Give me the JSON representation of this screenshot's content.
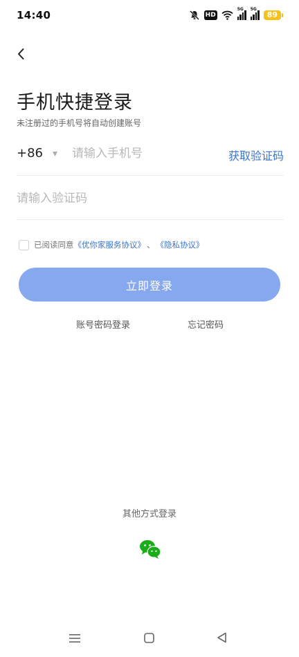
{
  "status_bar": {
    "time": "14:40",
    "hd_label": "HD",
    "network1": "5G",
    "network2": "5G",
    "battery": "89",
    "battery_color": "#f4c21a"
  },
  "header": {
    "back_icon": "chevron-left-icon"
  },
  "login": {
    "title": "手机快捷登录",
    "subtitle": "未注册过的手机号将自动创建账号",
    "country_code": "+86",
    "phone_placeholder": "请输入手机号",
    "get_code_label": "获取验证码",
    "code_placeholder": "请输入验证码",
    "agreement_prefix": "已阅读同意",
    "agreement_link1": "《优你家服务协议》",
    "agreement_sep": "、",
    "agreement_link2": "《隐私协议》",
    "submit_label": "立即登录",
    "password_login_label": "账号密码登录",
    "forgot_password_label": "忘记密码",
    "accent_color": "#3b74c9",
    "button_color": "#86a8ee"
  },
  "other": {
    "label": "其他方式登录",
    "wechat_icon": "wechat-icon",
    "wechat_color": "#1aad19"
  },
  "nav_bar": {
    "menu_icon": "menu-icon",
    "home_icon": "square-home-icon",
    "back_icon": "triangle-back-icon"
  }
}
